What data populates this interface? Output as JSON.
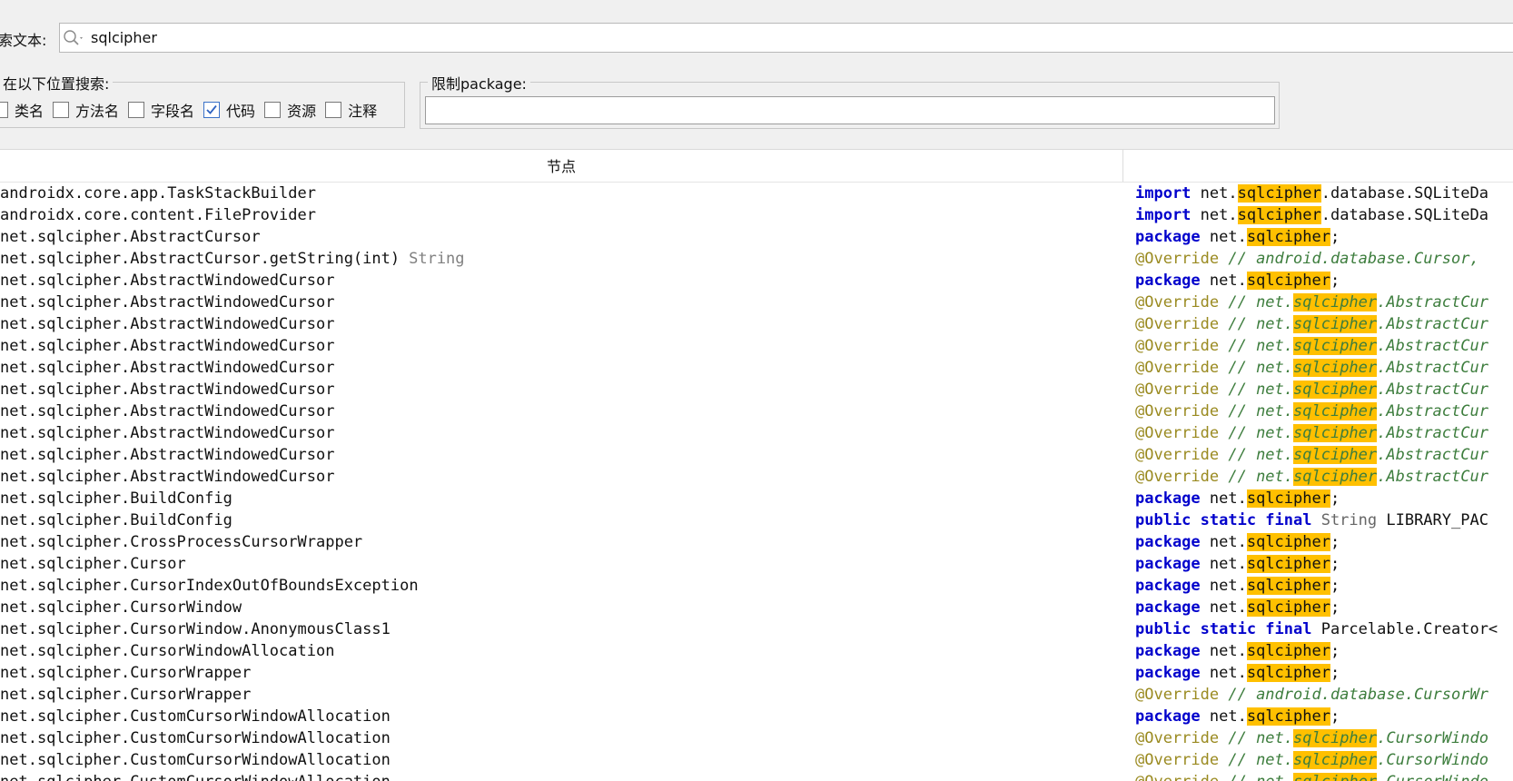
{
  "search": {
    "label": "索文本:",
    "value": "sqlcipher"
  },
  "search_in": {
    "title": "在以下位置搜索:",
    "options": [
      {
        "label": "类名",
        "checked": false
      },
      {
        "label": "方法名",
        "checked": false
      },
      {
        "label": "字段名",
        "checked": false
      },
      {
        "label": "代码",
        "checked": true
      },
      {
        "label": "资源",
        "checked": false
      },
      {
        "label": "注释",
        "checked": false
      }
    ]
  },
  "restrict_package": {
    "title": "限制package:",
    "value": ""
  },
  "table": {
    "columns": [
      "节点",
      ""
    ],
    "rows": [
      {
        "node": "androidx.core.app.TaskStackBuilder",
        "type": "",
        "code": [
          {
            "t": "import",
            "s": "kw"
          },
          {
            "t": " net.",
            "s": "plain"
          },
          {
            "t": "sqlcipher",
            "s": "hl"
          },
          {
            "t": ".database.SQLiteDa",
            "s": "plain"
          }
        ]
      },
      {
        "node": "androidx.core.content.FileProvider",
        "type": "",
        "code": [
          {
            "t": "import",
            "s": "kw"
          },
          {
            "t": " net.",
            "s": "plain"
          },
          {
            "t": "sqlcipher",
            "s": "hl"
          },
          {
            "t": ".database.SQLiteDa",
            "s": "plain"
          }
        ]
      },
      {
        "node": "net.sqlcipher.AbstractCursor",
        "type": "",
        "code": [
          {
            "t": "package",
            "s": "kw"
          },
          {
            "t": " net.",
            "s": "plain"
          },
          {
            "t": "sqlcipher",
            "s": "hl"
          },
          {
            "t": ";",
            "s": "plain"
          }
        ]
      },
      {
        "node": "net.sqlcipher.AbstractCursor.getString(int)",
        "type": "String",
        "code": [
          {
            "t": "@Override",
            "s": "ann"
          },
          {
            "t": " // android.database.Cursor,",
            "s": "cmt"
          }
        ]
      },
      {
        "node": "net.sqlcipher.AbstractWindowedCursor",
        "type": "",
        "code": [
          {
            "t": "package",
            "s": "kw"
          },
          {
            "t": " net.",
            "s": "plain"
          },
          {
            "t": "sqlcipher",
            "s": "hl"
          },
          {
            "t": ";",
            "s": "plain"
          }
        ]
      },
      {
        "node": "net.sqlcipher.AbstractWindowedCursor",
        "type": "",
        "code": [
          {
            "t": "@Override",
            "s": "ann"
          },
          {
            "t": " // net.",
            "s": "cmt"
          },
          {
            "t": "sqlcipher",
            "s": "hl cmt"
          },
          {
            "t": ".AbstractCur",
            "s": "cmt"
          }
        ]
      },
      {
        "node": "net.sqlcipher.AbstractWindowedCursor",
        "type": "",
        "code": [
          {
            "t": "@Override",
            "s": "ann"
          },
          {
            "t": " // net.",
            "s": "cmt"
          },
          {
            "t": "sqlcipher",
            "s": "hl cmt"
          },
          {
            "t": ".AbstractCur",
            "s": "cmt"
          }
        ]
      },
      {
        "node": "net.sqlcipher.AbstractWindowedCursor",
        "type": "",
        "code": [
          {
            "t": "@Override",
            "s": "ann"
          },
          {
            "t": " // net.",
            "s": "cmt"
          },
          {
            "t": "sqlcipher",
            "s": "hl cmt"
          },
          {
            "t": ".AbstractCur",
            "s": "cmt"
          }
        ]
      },
      {
        "node": "net.sqlcipher.AbstractWindowedCursor",
        "type": "",
        "code": [
          {
            "t": "@Override",
            "s": "ann"
          },
          {
            "t": " // net.",
            "s": "cmt"
          },
          {
            "t": "sqlcipher",
            "s": "hl cmt"
          },
          {
            "t": ".AbstractCur",
            "s": "cmt"
          }
        ]
      },
      {
        "node": "net.sqlcipher.AbstractWindowedCursor",
        "type": "",
        "code": [
          {
            "t": "@Override",
            "s": "ann"
          },
          {
            "t": " // net.",
            "s": "cmt"
          },
          {
            "t": "sqlcipher",
            "s": "hl cmt"
          },
          {
            "t": ".AbstractCur",
            "s": "cmt"
          }
        ]
      },
      {
        "node": "net.sqlcipher.AbstractWindowedCursor",
        "type": "",
        "code": [
          {
            "t": "@Override",
            "s": "ann"
          },
          {
            "t": " // net.",
            "s": "cmt"
          },
          {
            "t": "sqlcipher",
            "s": "hl cmt"
          },
          {
            "t": ".AbstractCur",
            "s": "cmt"
          }
        ]
      },
      {
        "node": "net.sqlcipher.AbstractWindowedCursor",
        "type": "",
        "code": [
          {
            "t": "@Override",
            "s": "ann"
          },
          {
            "t": " // net.",
            "s": "cmt"
          },
          {
            "t": "sqlcipher",
            "s": "hl cmt"
          },
          {
            "t": ".AbstractCur",
            "s": "cmt"
          }
        ]
      },
      {
        "node": "net.sqlcipher.AbstractWindowedCursor",
        "type": "",
        "code": [
          {
            "t": "@Override",
            "s": "ann"
          },
          {
            "t": " // net.",
            "s": "cmt"
          },
          {
            "t": "sqlcipher",
            "s": "hl cmt"
          },
          {
            "t": ".AbstractCur",
            "s": "cmt"
          }
        ]
      },
      {
        "node": "net.sqlcipher.AbstractWindowedCursor",
        "type": "",
        "code": [
          {
            "t": "@Override",
            "s": "ann"
          },
          {
            "t": " // net.",
            "s": "cmt"
          },
          {
            "t": "sqlcipher",
            "s": "hl cmt"
          },
          {
            "t": ".AbstractCur",
            "s": "cmt"
          }
        ]
      },
      {
        "node": "net.sqlcipher.BuildConfig",
        "type": "",
        "code": [
          {
            "t": "package",
            "s": "kw"
          },
          {
            "t": " net.",
            "s": "plain"
          },
          {
            "t": "sqlcipher",
            "s": "hl"
          },
          {
            "t": ";",
            "s": "plain"
          }
        ]
      },
      {
        "node": "net.sqlcipher.BuildConfig",
        "type": "",
        "code": [
          {
            "t": "public static final",
            "s": "kw"
          },
          {
            "t": " String",
            "s": "tname"
          },
          {
            "t": " LIBRARY_PAC",
            "s": "plain"
          }
        ]
      },
      {
        "node": "net.sqlcipher.CrossProcessCursorWrapper",
        "type": "",
        "code": [
          {
            "t": "package",
            "s": "kw"
          },
          {
            "t": " net.",
            "s": "plain"
          },
          {
            "t": "sqlcipher",
            "s": "hl"
          },
          {
            "t": ";",
            "s": "plain"
          }
        ]
      },
      {
        "node": "net.sqlcipher.Cursor",
        "type": "",
        "code": [
          {
            "t": "package",
            "s": "kw"
          },
          {
            "t": " net.",
            "s": "plain"
          },
          {
            "t": "sqlcipher",
            "s": "hl"
          },
          {
            "t": ";",
            "s": "plain"
          }
        ]
      },
      {
        "node": "net.sqlcipher.CursorIndexOutOfBoundsException",
        "type": "",
        "code": [
          {
            "t": "package",
            "s": "kw"
          },
          {
            "t": " net.",
            "s": "plain"
          },
          {
            "t": "sqlcipher",
            "s": "hl"
          },
          {
            "t": ";",
            "s": "plain"
          }
        ]
      },
      {
        "node": "net.sqlcipher.CursorWindow",
        "type": "",
        "code": [
          {
            "t": "package",
            "s": "kw"
          },
          {
            "t": " net.",
            "s": "plain"
          },
          {
            "t": "sqlcipher",
            "s": "hl"
          },
          {
            "t": ";",
            "s": "plain"
          }
        ]
      },
      {
        "node": "net.sqlcipher.CursorWindow.AnonymousClass1",
        "type": "",
        "code": [
          {
            "t": "public static final",
            "s": "kw"
          },
          {
            "t": " Parcelable.Creator<",
            "s": "plain"
          }
        ]
      },
      {
        "node": "net.sqlcipher.CursorWindowAllocation",
        "type": "",
        "code": [
          {
            "t": "package",
            "s": "kw"
          },
          {
            "t": " net.",
            "s": "plain"
          },
          {
            "t": "sqlcipher",
            "s": "hl"
          },
          {
            "t": ";",
            "s": "plain"
          }
        ]
      },
      {
        "node": "net.sqlcipher.CursorWrapper",
        "type": "",
        "code": [
          {
            "t": "package",
            "s": "kw"
          },
          {
            "t": " net.",
            "s": "plain"
          },
          {
            "t": "sqlcipher",
            "s": "hl"
          },
          {
            "t": ";",
            "s": "plain"
          }
        ]
      },
      {
        "node": "net.sqlcipher.CursorWrapper",
        "type": "",
        "code": [
          {
            "t": "@Override",
            "s": "ann"
          },
          {
            "t": " // android.database.CursorWr",
            "s": "cmt"
          }
        ]
      },
      {
        "node": "net.sqlcipher.CustomCursorWindowAllocation",
        "type": "",
        "code": [
          {
            "t": "package",
            "s": "kw"
          },
          {
            "t": " net.",
            "s": "plain"
          },
          {
            "t": "sqlcipher",
            "s": "hl"
          },
          {
            "t": ";",
            "s": "plain"
          }
        ]
      },
      {
        "node": "net.sqlcipher.CustomCursorWindowAllocation",
        "type": "",
        "code": [
          {
            "t": "@Override",
            "s": "ann"
          },
          {
            "t": " // net.",
            "s": "cmt"
          },
          {
            "t": "sqlcipher",
            "s": "hl cmt"
          },
          {
            "t": ".CursorWindo",
            "s": "cmt"
          }
        ]
      },
      {
        "node": "net.sqlcipher.CustomCursorWindowAllocation",
        "type": "",
        "code": [
          {
            "t": "@Override",
            "s": "ann"
          },
          {
            "t": " // net.",
            "s": "cmt"
          },
          {
            "t": "sqlcipher",
            "s": "hl cmt"
          },
          {
            "t": ".CursorWindo",
            "s": "cmt"
          }
        ]
      },
      {
        "node": "net.sqlcipher.CustomCursorWindowAllocation",
        "type": "",
        "code": [
          {
            "t": "@Override",
            "s": "ann"
          },
          {
            "t": " // net.",
            "s": "cmt"
          },
          {
            "t": "sqlcipher",
            "s": "hl cmt"
          },
          {
            "t": ".CursorWindo",
            "s": "cmt"
          }
        ]
      }
    ]
  }
}
